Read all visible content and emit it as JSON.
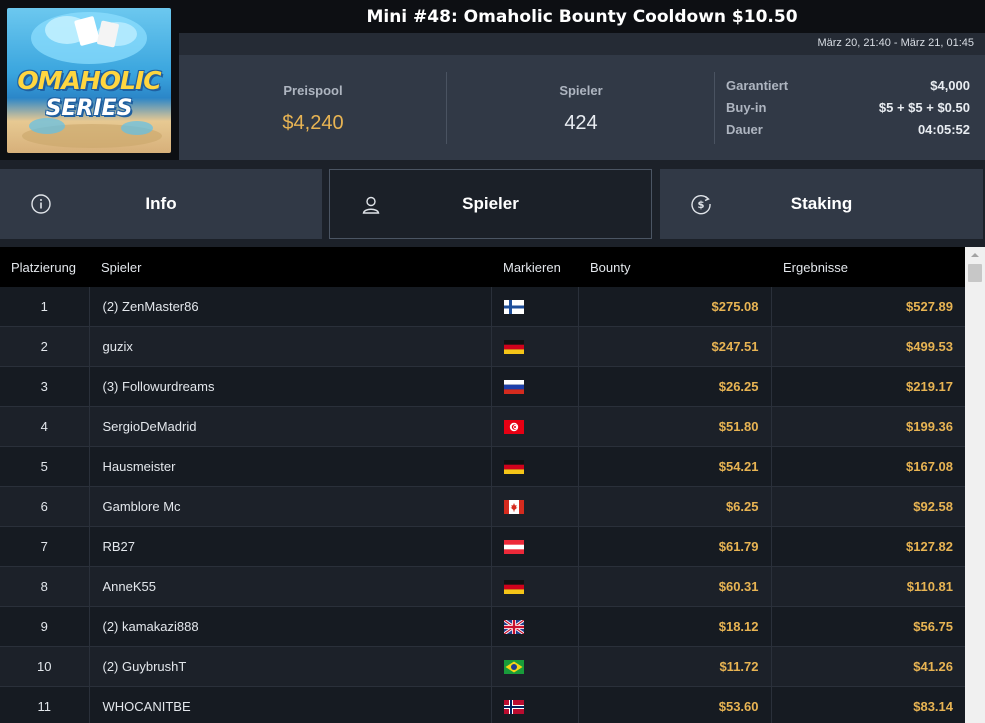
{
  "header": {
    "title": "Mini #48: Omaholic Bounty Cooldown $10.50",
    "date_range": "März 20, 21:40 - März 21, 01:45",
    "logo_text_1": "OMAHOLIC",
    "logo_text_2": "SERIES"
  },
  "stats": {
    "prizepool_label": "Preispool",
    "prizepool_value": "$4,240",
    "players_label": "Spieler",
    "players_value": "424",
    "details": [
      {
        "label": "Garantiert",
        "value": "$4,000"
      },
      {
        "label": "Buy-in",
        "value": "$5 + $5 + $0.50"
      },
      {
        "label": "Dauer",
        "value": "04:05:52"
      }
    ]
  },
  "tabs": [
    {
      "label": "Info",
      "icon": "info-circle-icon"
    },
    {
      "label": "Spieler",
      "icon": "user-icon"
    },
    {
      "label": "Staking",
      "icon": "dollar-circle-icon"
    }
  ],
  "table": {
    "columns": [
      "Platzierung",
      "Spieler",
      "Markieren",
      "Bounty",
      "Ergebnisse"
    ],
    "rows": [
      {
        "place": "1",
        "player": "(2) ZenMaster86",
        "flag": "finland",
        "bounty": "$275.08",
        "result": "$527.89"
      },
      {
        "place": "2",
        "player": "guzix",
        "flag": "germany",
        "bounty": "$247.51",
        "result": "$499.53"
      },
      {
        "place": "3",
        "player": "(3) Followurdreams",
        "flag": "russia",
        "bounty": "$26.25",
        "result": "$219.17"
      },
      {
        "place": "4",
        "player": "SergioDeMadrid",
        "flag": "tunisia",
        "bounty": "$51.80",
        "result": "$199.36"
      },
      {
        "place": "5",
        "player": "Hausmeister",
        "flag": "germany",
        "bounty": "$54.21",
        "result": "$167.08"
      },
      {
        "place": "6",
        "player": "Gamblore Mc",
        "flag": "canada",
        "bounty": "$6.25",
        "result": "$92.58"
      },
      {
        "place": "7",
        "player": "RB27",
        "flag": "austria",
        "bounty": "$61.79",
        "result": "$127.82"
      },
      {
        "place": "8",
        "player": "AnneK55",
        "flag": "germany",
        "bounty": "$60.31",
        "result": "$110.81"
      },
      {
        "place": "9",
        "player": "(2) kamakazi888",
        "flag": "uk",
        "bounty": "$18.12",
        "result": "$56.75"
      },
      {
        "place": "10",
        "player": "(2) GuybrushT",
        "flag": "brazil",
        "bounty": "$11.72",
        "result": "$41.26"
      },
      {
        "place": "11",
        "player": "WHOCANITBE",
        "flag": "norway",
        "bounty": "$53.60",
        "result": "$83.14"
      }
    ]
  },
  "colors": {
    "accent_gold": "#e8b453",
    "panel": "#313946",
    "background": "#1c2129"
  }
}
